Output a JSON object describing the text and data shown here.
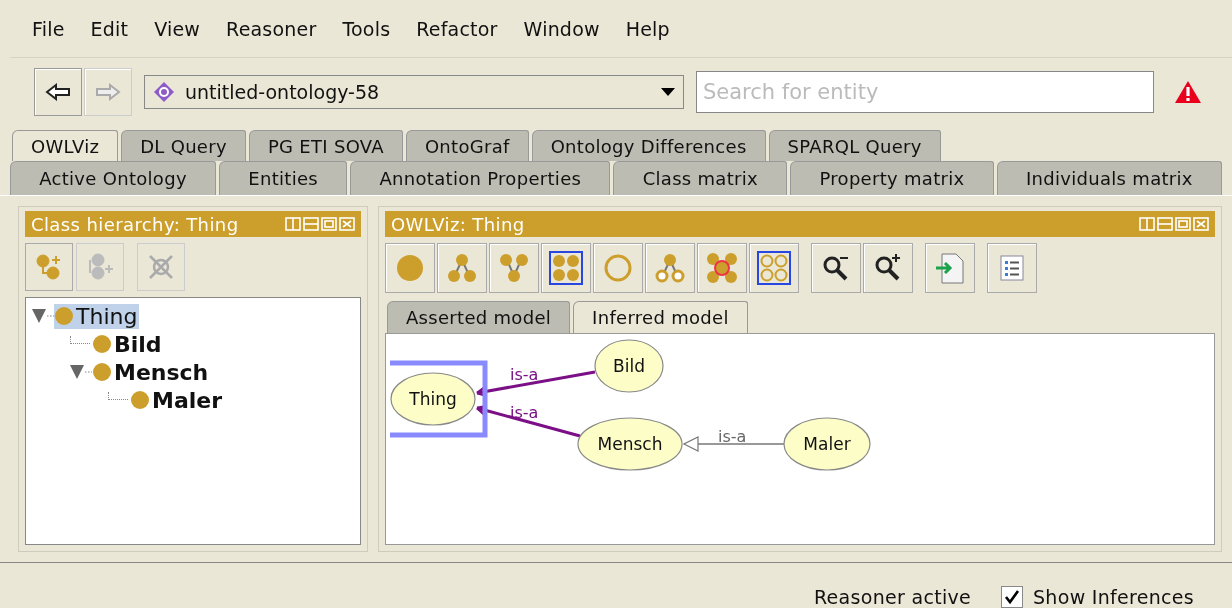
{
  "menu": [
    "File",
    "Edit",
    "View",
    "Reasoner",
    "Tools",
    "Refactor",
    "Window",
    "Help"
  ],
  "navigation": {
    "back_disabled": false,
    "forward_disabled": true
  },
  "ontology": "untitled-ontology-58",
  "search": {
    "placeholder": "Search for entity"
  },
  "tabs_top": [
    {
      "label": "OWLViz",
      "selected": true
    },
    {
      "label": "DL Query",
      "selected": false
    },
    {
      "label": "PG ETI SOVA",
      "selected": false
    },
    {
      "label": "OntoGraf",
      "selected": false
    },
    {
      "label": "Ontology Differences",
      "selected": false
    },
    {
      "label": "SPARQL Query",
      "selected": false
    }
  ],
  "tabs_bottom": [
    {
      "label": "Active Ontology",
      "selected": false
    },
    {
      "label": "Entities",
      "selected": false
    },
    {
      "label": "Annotation Properties",
      "selected": false
    },
    {
      "label": "Class matrix",
      "selected": false
    },
    {
      "label": "Property matrix",
      "selected": false
    },
    {
      "label": "Individuals matrix",
      "selected": false
    }
  ],
  "class_hierarchy": {
    "title": "Class hierarchy: Thing",
    "buttons": [
      {
        "kind": "add-subclass",
        "disabled": false
      },
      {
        "kind": "add-sibling",
        "disabled": true
      },
      {
        "kind": "delete",
        "disabled": true
      }
    ],
    "tree": [
      {
        "label": "Thing",
        "selected": true,
        "bold": false,
        "expanded": true,
        "children": [
          {
            "label": "Bild",
            "selected": false,
            "bold": true
          },
          {
            "label": "Mensch",
            "selected": false,
            "bold": true,
            "expanded": true,
            "children": [
              {
                "label": "Maler",
                "selected": false,
                "bold": true
              }
            ]
          }
        ]
      }
    ]
  },
  "owlviz": {
    "title": "OWLViz: Thing",
    "tabs": [
      {
        "label": "Asserted model",
        "selected": false
      },
      {
        "label": "Inferred model",
        "selected": true
      }
    ],
    "nodes": [
      {
        "label": "Thing",
        "selected": true
      },
      {
        "label": "Bild",
        "selected": false
      },
      {
        "label": "Mensch",
        "selected": false
      },
      {
        "label": "Maler",
        "selected": false
      }
    ],
    "edges": [
      {
        "label": "is-a",
        "inferred": true
      },
      {
        "label": "is-a",
        "inferred": true
      },
      {
        "label": "is-a",
        "inferred": false
      }
    ]
  },
  "status": {
    "reasoner": "Reasoner active",
    "show_inferences": {
      "label": "Show Inferences",
      "checked": true
    }
  }
}
